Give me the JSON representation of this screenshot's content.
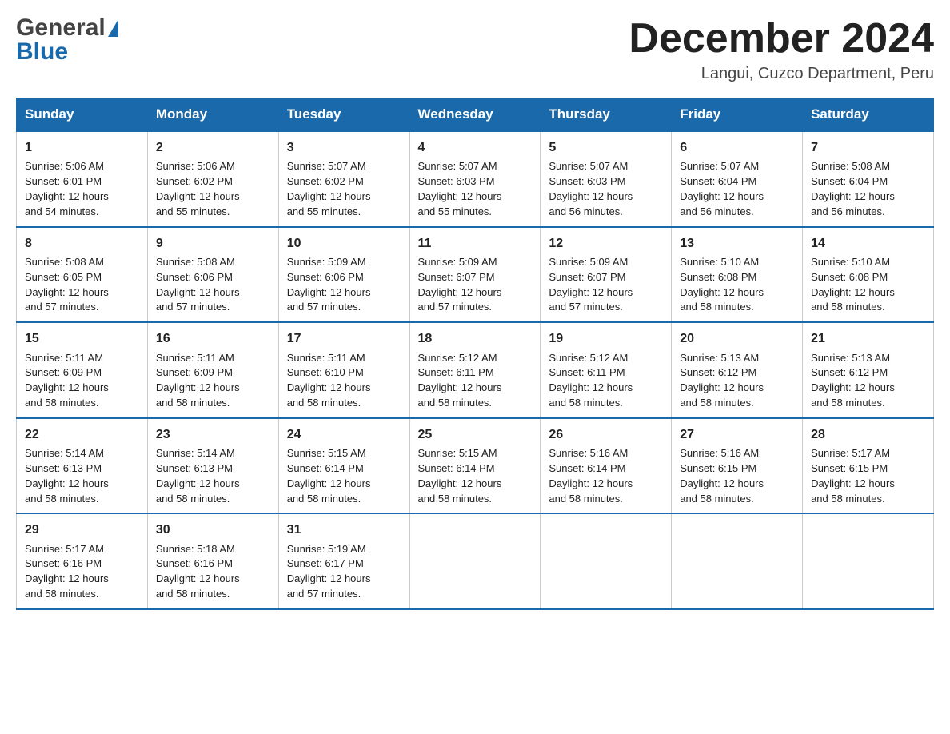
{
  "header": {
    "logo_general": "General",
    "logo_blue": "Blue",
    "month_title": "December 2024",
    "location": "Langui, Cuzco Department, Peru"
  },
  "days_of_week": [
    "Sunday",
    "Monday",
    "Tuesday",
    "Wednesday",
    "Thursday",
    "Friday",
    "Saturday"
  ],
  "weeks": [
    {
      "days": [
        {
          "num": "1",
          "info": "Sunrise: 5:06 AM\nSunset: 6:01 PM\nDaylight: 12 hours\nand 54 minutes."
        },
        {
          "num": "2",
          "info": "Sunrise: 5:06 AM\nSunset: 6:02 PM\nDaylight: 12 hours\nand 55 minutes."
        },
        {
          "num": "3",
          "info": "Sunrise: 5:07 AM\nSunset: 6:02 PM\nDaylight: 12 hours\nand 55 minutes."
        },
        {
          "num": "4",
          "info": "Sunrise: 5:07 AM\nSunset: 6:03 PM\nDaylight: 12 hours\nand 55 minutes."
        },
        {
          "num": "5",
          "info": "Sunrise: 5:07 AM\nSunset: 6:03 PM\nDaylight: 12 hours\nand 56 minutes."
        },
        {
          "num": "6",
          "info": "Sunrise: 5:07 AM\nSunset: 6:04 PM\nDaylight: 12 hours\nand 56 minutes."
        },
        {
          "num": "7",
          "info": "Sunrise: 5:08 AM\nSunset: 6:04 PM\nDaylight: 12 hours\nand 56 minutes."
        }
      ]
    },
    {
      "days": [
        {
          "num": "8",
          "info": "Sunrise: 5:08 AM\nSunset: 6:05 PM\nDaylight: 12 hours\nand 57 minutes."
        },
        {
          "num": "9",
          "info": "Sunrise: 5:08 AM\nSunset: 6:06 PM\nDaylight: 12 hours\nand 57 minutes."
        },
        {
          "num": "10",
          "info": "Sunrise: 5:09 AM\nSunset: 6:06 PM\nDaylight: 12 hours\nand 57 minutes."
        },
        {
          "num": "11",
          "info": "Sunrise: 5:09 AM\nSunset: 6:07 PM\nDaylight: 12 hours\nand 57 minutes."
        },
        {
          "num": "12",
          "info": "Sunrise: 5:09 AM\nSunset: 6:07 PM\nDaylight: 12 hours\nand 57 minutes."
        },
        {
          "num": "13",
          "info": "Sunrise: 5:10 AM\nSunset: 6:08 PM\nDaylight: 12 hours\nand 58 minutes."
        },
        {
          "num": "14",
          "info": "Sunrise: 5:10 AM\nSunset: 6:08 PM\nDaylight: 12 hours\nand 58 minutes."
        }
      ]
    },
    {
      "days": [
        {
          "num": "15",
          "info": "Sunrise: 5:11 AM\nSunset: 6:09 PM\nDaylight: 12 hours\nand 58 minutes."
        },
        {
          "num": "16",
          "info": "Sunrise: 5:11 AM\nSunset: 6:09 PM\nDaylight: 12 hours\nand 58 minutes."
        },
        {
          "num": "17",
          "info": "Sunrise: 5:11 AM\nSunset: 6:10 PM\nDaylight: 12 hours\nand 58 minutes."
        },
        {
          "num": "18",
          "info": "Sunrise: 5:12 AM\nSunset: 6:11 PM\nDaylight: 12 hours\nand 58 minutes."
        },
        {
          "num": "19",
          "info": "Sunrise: 5:12 AM\nSunset: 6:11 PM\nDaylight: 12 hours\nand 58 minutes."
        },
        {
          "num": "20",
          "info": "Sunrise: 5:13 AM\nSunset: 6:12 PM\nDaylight: 12 hours\nand 58 minutes."
        },
        {
          "num": "21",
          "info": "Sunrise: 5:13 AM\nSunset: 6:12 PM\nDaylight: 12 hours\nand 58 minutes."
        }
      ]
    },
    {
      "days": [
        {
          "num": "22",
          "info": "Sunrise: 5:14 AM\nSunset: 6:13 PM\nDaylight: 12 hours\nand 58 minutes."
        },
        {
          "num": "23",
          "info": "Sunrise: 5:14 AM\nSunset: 6:13 PM\nDaylight: 12 hours\nand 58 minutes."
        },
        {
          "num": "24",
          "info": "Sunrise: 5:15 AM\nSunset: 6:14 PM\nDaylight: 12 hours\nand 58 minutes."
        },
        {
          "num": "25",
          "info": "Sunrise: 5:15 AM\nSunset: 6:14 PM\nDaylight: 12 hours\nand 58 minutes."
        },
        {
          "num": "26",
          "info": "Sunrise: 5:16 AM\nSunset: 6:14 PM\nDaylight: 12 hours\nand 58 minutes."
        },
        {
          "num": "27",
          "info": "Sunrise: 5:16 AM\nSunset: 6:15 PM\nDaylight: 12 hours\nand 58 minutes."
        },
        {
          "num": "28",
          "info": "Sunrise: 5:17 AM\nSunset: 6:15 PM\nDaylight: 12 hours\nand 58 minutes."
        }
      ]
    },
    {
      "days": [
        {
          "num": "29",
          "info": "Sunrise: 5:17 AM\nSunset: 6:16 PM\nDaylight: 12 hours\nand 58 minutes."
        },
        {
          "num": "30",
          "info": "Sunrise: 5:18 AM\nSunset: 6:16 PM\nDaylight: 12 hours\nand 58 minutes."
        },
        {
          "num": "31",
          "info": "Sunrise: 5:19 AM\nSunset: 6:17 PM\nDaylight: 12 hours\nand 57 minutes."
        },
        {
          "num": "",
          "info": ""
        },
        {
          "num": "",
          "info": ""
        },
        {
          "num": "",
          "info": ""
        },
        {
          "num": "",
          "info": ""
        }
      ]
    }
  ],
  "colors": {
    "header_bg": "#1a6aab",
    "header_text": "#ffffff",
    "border": "#cccccc",
    "text": "#222222"
  }
}
